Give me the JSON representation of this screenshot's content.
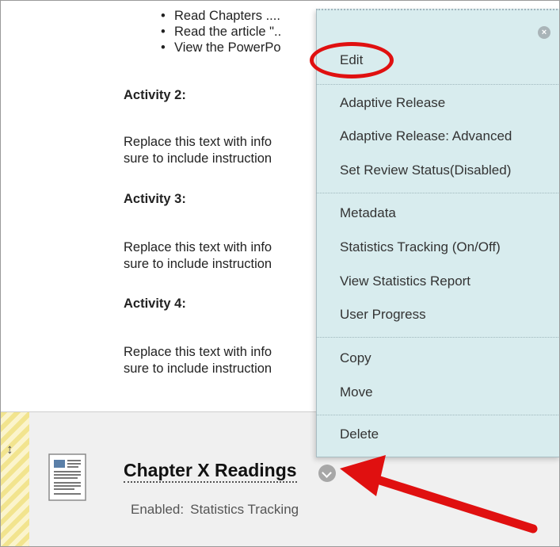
{
  "content": {
    "bullets": [
      "Read Chapters ....",
      "Read the article \"..",
      "View the PowerPo"
    ],
    "activities": [
      {
        "heading": "Activity 2:",
        "body": "Replace this text with info\nsure to include instruction"
      },
      {
        "heading": "Activity 3:",
        "body": "Replace this text with info\nsure to include instruction"
      },
      {
        "heading": "Activity 4:",
        "body": "Replace this text with info\nsure to include instruction"
      }
    ]
  },
  "menu": {
    "close_icon": "close-icon",
    "items": [
      "Edit",
      "Adaptive Release",
      "Adaptive Release: Advanced",
      "Set Review Status(Disabled)",
      "Metadata",
      "Statistics Tracking (On/Off)",
      "View Statistics Report",
      "User Progress",
      "Copy",
      "Move",
      "Delete"
    ]
  },
  "item": {
    "title": "Chapter X Readings",
    "status_label": "Enabled:",
    "status_value": "Statistics Tracking",
    "icons": {
      "drag": "drag-handle-icon",
      "document": "document-icon",
      "chevron": "chevron-down-icon"
    }
  },
  "colors": {
    "menu_bg": "#d8ecee",
    "highlight": "#e01010",
    "drag_strip": "#f2e48e"
  }
}
